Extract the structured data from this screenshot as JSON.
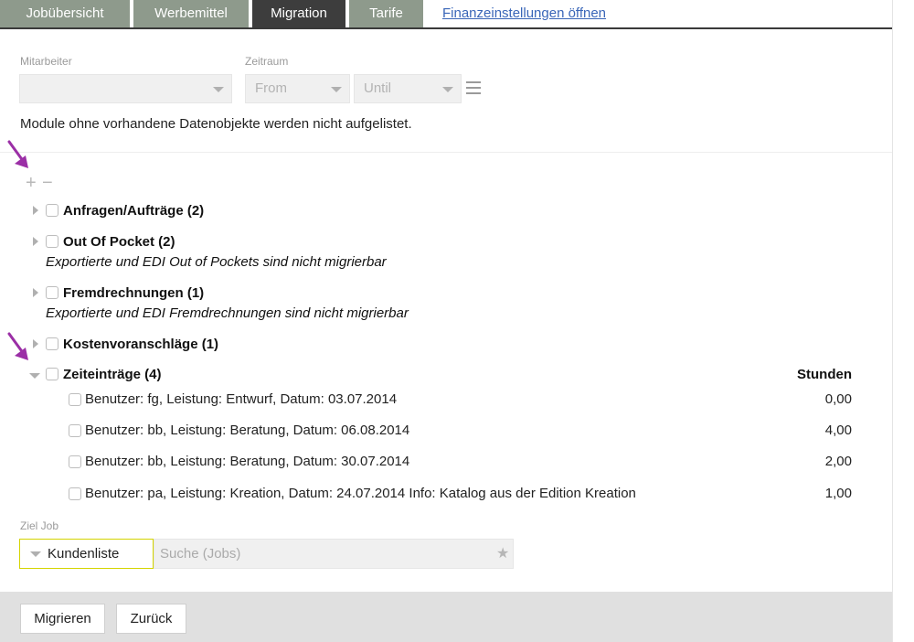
{
  "tabs": [
    {
      "label": "Jobübersicht"
    },
    {
      "label": "Werbemittel"
    },
    {
      "label": "Migration"
    },
    {
      "label": "Tarife"
    }
  ],
  "tab_link": "Finanzeinstellungen öffnen",
  "filters": {
    "employee_label": "Mitarbeiter",
    "employee_value": "",
    "period_label": "Zeitraum",
    "from_value": "From",
    "until_value": "Until"
  },
  "note": "Module ohne vorhandene Datenobjekte werden nicht aufgelistet.",
  "expand_controls": {
    "plus": "+",
    "minus": "−"
  },
  "modules": [
    {
      "label": "Anfragen/Aufträge (2)",
      "sub": ""
    },
    {
      "label": "Out Of Pocket (2)",
      "sub": "Exportierte und EDI Out of Pockets sind nicht migrierbar"
    },
    {
      "label": "Fremdrechnungen (1)",
      "sub": "Exportierte und EDI Fremdrechnungen sind nicht migrierbar"
    },
    {
      "label": "Kostenvoranschläge (1)",
      "sub": ""
    }
  ],
  "time_entries": {
    "label": "Zeiteinträge (4)",
    "column_header": "Stunden",
    "entries": [
      {
        "text": "Benutzer: fg, Leistung: Entwurf, Datum: 03.07.2014",
        "hours": "0,00"
      },
      {
        "text": "Benutzer: bb, Leistung: Beratung, Datum: 06.08.2014",
        "hours": "4,00"
      },
      {
        "text": "Benutzer: bb, Leistung: Beratung, Datum: 30.07.2014",
        "hours": "2,00"
      },
      {
        "text": "Benutzer: pa, Leistung: Kreation, Datum: 24.07.2014 Info: Katalog aus der Edition Kreation",
        "hours": "1,00"
      }
    ]
  },
  "target_job": {
    "label": "Ziel Job",
    "list_value": "Kundenliste",
    "search_placeholder": "Suche (Jobs)"
  },
  "buttons": {
    "migrate": "Migrieren",
    "back": "Zurück"
  },
  "colors": {
    "tab_inactive": "#8e9a8c",
    "tab_active": "#3d3d3d",
    "link": "#3a66b8",
    "arrow": "#9b2fa6",
    "highlight_border": "#d4d400"
  }
}
